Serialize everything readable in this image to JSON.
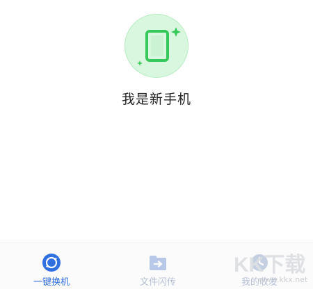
{
  "role": {
    "title": "我是新手机",
    "icon": "phone-sparkle-icon"
  },
  "tabbar": {
    "tabs": [
      {
        "label": "一键换机",
        "icon": "sync-icon",
        "active": true
      },
      {
        "label": "文件闪传",
        "icon": "folder-transfer-icon",
        "active": false
      },
      {
        "label": "我的收发",
        "icon": "history-icon",
        "active": false
      }
    ]
  },
  "colors": {
    "accent": "#2f6fe0",
    "badge_fill": "#d9f7df",
    "badge_icon": "#37c85a",
    "inactive": "#b7c1d8"
  },
  "watermark": {
    "logo_text": "KK下载",
    "url": "www.kkx.net"
  }
}
